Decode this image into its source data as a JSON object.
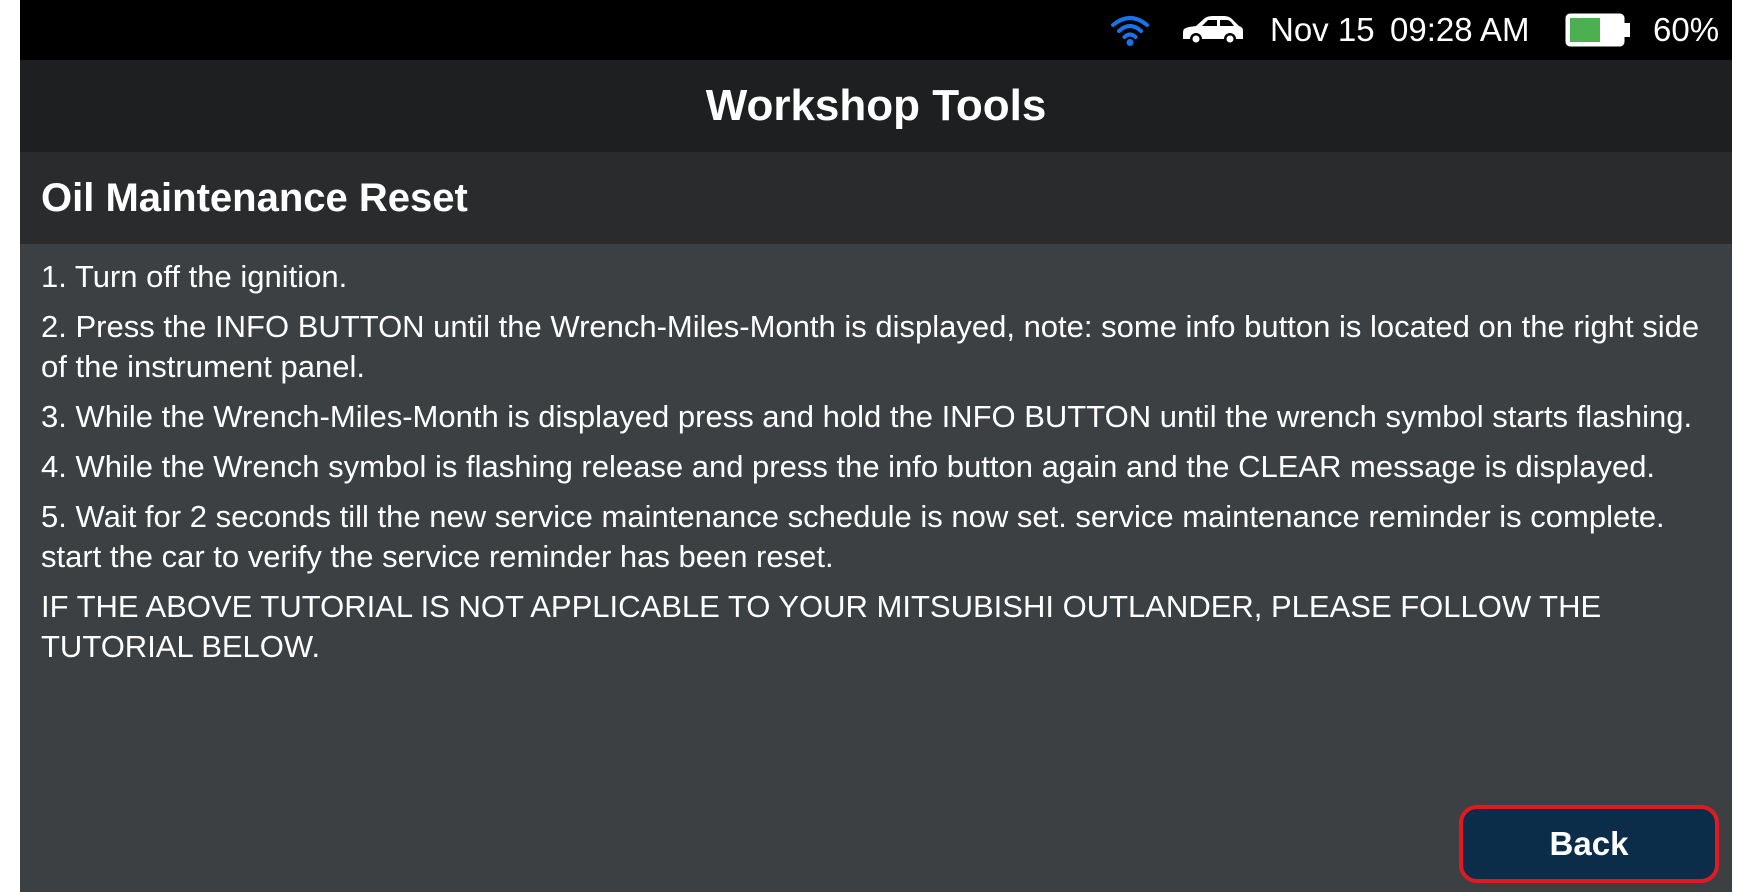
{
  "status_bar": {
    "wifi_icon": "wifi-icon",
    "car_icon": "car-icon",
    "date": "Nov 15",
    "time": "09:28 AM",
    "battery_icon": "battery-icon",
    "battery_percent": "60%",
    "battery_level": 0.6,
    "colors": {
      "wifi": "#1a73e8",
      "battery_fill": "#4caf50"
    }
  },
  "header": {
    "title": "Workshop Tools"
  },
  "section": {
    "title": "Oil Maintenance Reset"
  },
  "instructions": [
    "1. Turn off the ignition.",
    "2. Press the INFO BUTTON until the Wrench-Miles-Month is displayed, note: some info button is located on the right side of the instrument panel.",
    "3. While the Wrench-Miles-Month is displayed press and hold the INFO BUTTON until the wrench symbol starts flashing.",
    "4. While the Wrench symbol is flashing release and press the info button again and the CLEAR message is displayed.",
    "5. Wait for 2 seconds till the new service maintenance schedule is now set. service maintenance reminder is complete. start the car to verify the service reminder has been reset.",
    "IF THE ABOVE TUTORIAL IS NOT APPLICABLE TO YOUR MITSUBISHI OUTLANDER, PLEASE FOLLOW THE TUTORIAL BELOW."
  ],
  "footer": {
    "back_label": "Back",
    "colors": {
      "button_bg": "#0c2d4a",
      "button_border": "#e11a22"
    }
  }
}
